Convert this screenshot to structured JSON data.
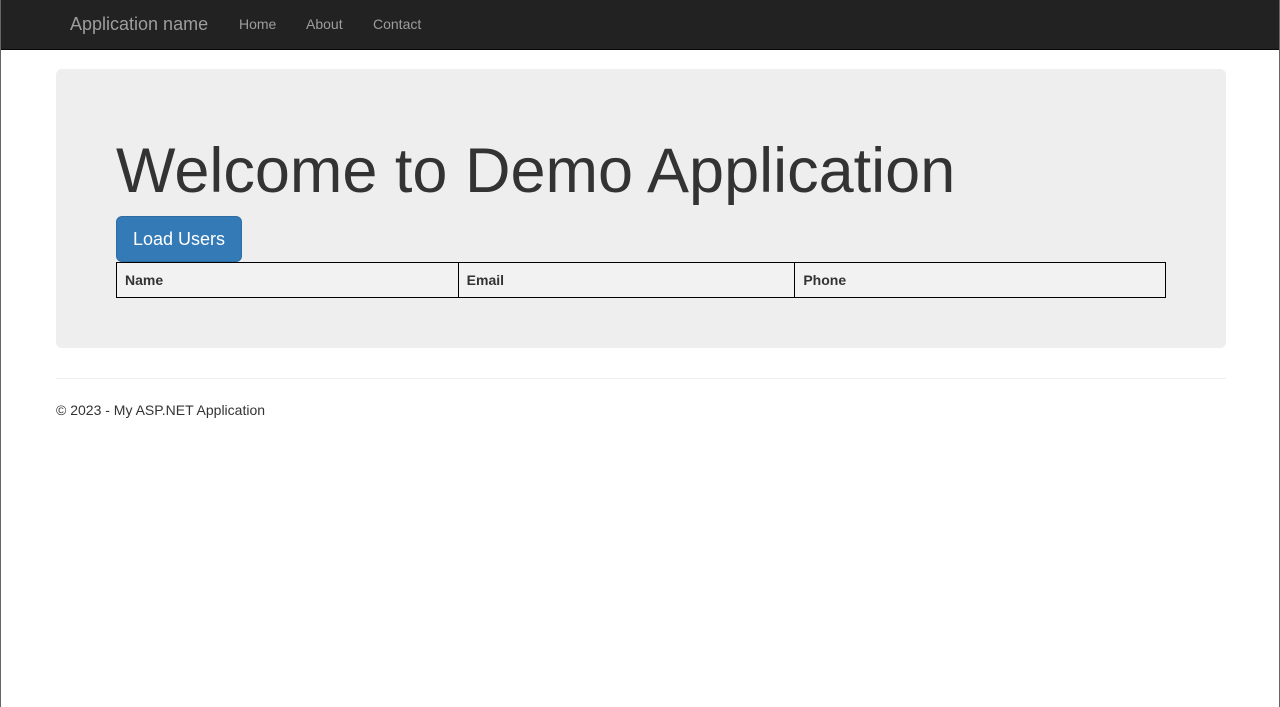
{
  "navbar": {
    "brand": "Application name",
    "links": [
      {
        "label": "Home"
      },
      {
        "label": "About"
      },
      {
        "label": "Contact"
      }
    ]
  },
  "main": {
    "title": "Welcome to Demo Application",
    "load_button_label": "Load Users",
    "table": {
      "headers": [
        "Name",
        "Email",
        "Phone"
      ],
      "rows": []
    }
  },
  "footer": {
    "text": "© 2023 - My ASP.NET Application"
  },
  "colors": {
    "navbar_bg": "#222222",
    "nav_text": "#9d9d9d",
    "jumbotron_bg": "#eeeeee",
    "primary_button": "#337ab7",
    "text": "#333333"
  }
}
